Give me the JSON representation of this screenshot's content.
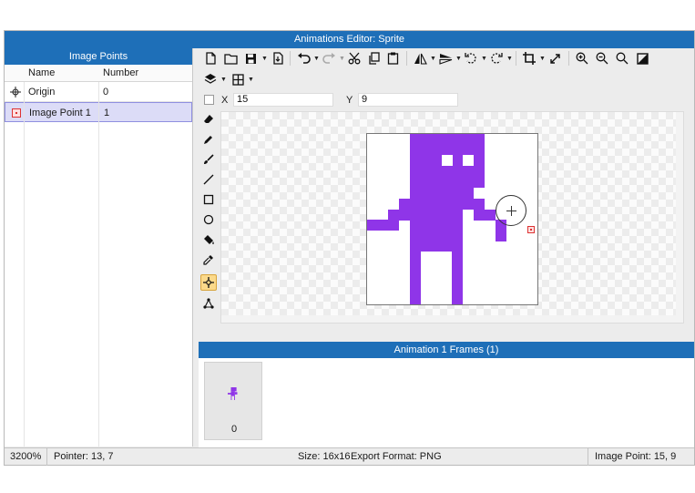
{
  "window": {
    "title": "Animations Editor: Sprite"
  },
  "image_points_panel": {
    "title": "Image Points",
    "columns": [
      "Name",
      "Number"
    ],
    "rows": [
      {
        "name": "Origin",
        "number": "0",
        "icon": "origin-crosshair-icon",
        "selected": false
      },
      {
        "name": "Image Point 1",
        "number": "1",
        "icon": "image-point-icon",
        "selected": true
      }
    ]
  },
  "coords": {
    "x_label": "X",
    "x_value": "15",
    "y_label": "Y",
    "y_value": "9"
  },
  "toolbar": {
    "icons": [
      "new-file-icon",
      "open-folder-icon",
      "save-icon",
      "import-icon",
      "undo-icon",
      "redo-icon",
      "cut-icon",
      "copy-icon",
      "paste-icon",
      "flip-horizontal-icon",
      "flip-vertical-icon",
      "rotate-left-icon",
      "rotate-right-icon",
      "crop-icon",
      "resize-icon",
      "zoom-in-icon",
      "zoom-out-icon",
      "zoom-reset-icon",
      "fit-icon",
      "layers-icon",
      "grid-icon"
    ]
  },
  "side_tools": [
    "eraser-icon",
    "pencil-icon",
    "brush-icon",
    "line-icon",
    "rectangle-icon",
    "ellipse-icon",
    "fill-bucket-icon",
    "eyedropper-icon",
    "image-point-tool-icon",
    "transform-icon"
  ],
  "frames_panel": {
    "title": "Animation 1 Frames (1)",
    "frames": [
      {
        "number": "0"
      }
    ]
  },
  "status": {
    "zoom": "3200%",
    "pointer": "Pointer: 13, 7",
    "size": "Size: 16x16",
    "export_format": "Export Format: PNG",
    "image_point": "Image Point: 15, 9"
  },
  "colors": {
    "accent": "#1e6fb8",
    "sprite": "#8f35e8",
    "selection": "#dcdcf7",
    "active_tool": "#fbd98a"
  }
}
